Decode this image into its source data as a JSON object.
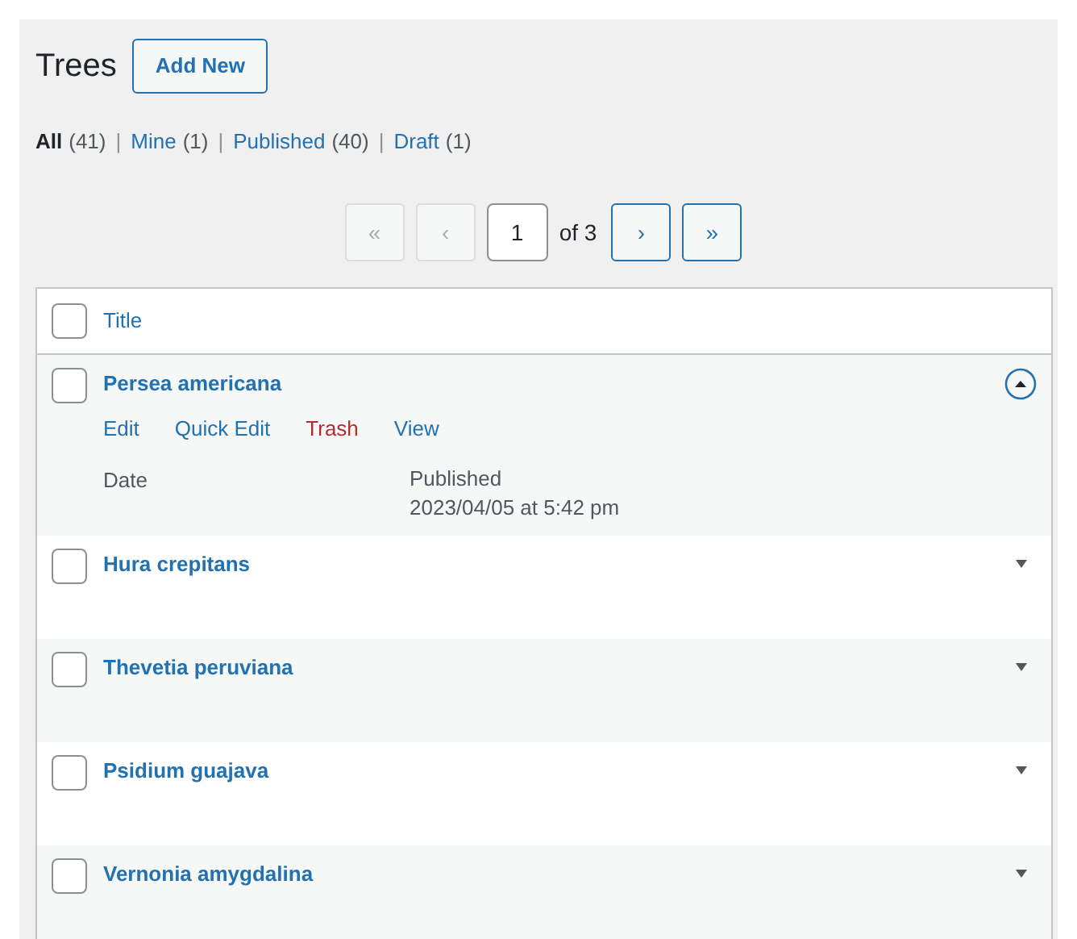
{
  "heading": {
    "title": "Trees",
    "add_button": "Add New"
  },
  "filters": [
    {
      "label": "All",
      "count": "(41)",
      "selected": true
    },
    {
      "separator": "|",
      "label": "Mine",
      "count": "(1)",
      "selected": false
    },
    {
      "separator": "|",
      "label": "Published",
      "count": "(40)",
      "selected": false
    },
    {
      "separator": "|",
      "label": "Draft",
      "count": "(1)",
      "selected": false
    }
  ],
  "pagination": {
    "first": "«",
    "prev": "‹",
    "page": "1",
    "of": "of 3",
    "next": "›",
    "last": "»",
    "first_disabled": true,
    "prev_disabled": true,
    "next_disabled": false,
    "last_disabled": false
  },
  "table": {
    "header": {
      "checked": false,
      "title": "Title"
    },
    "rows": [
      {
        "title": "Persea americana",
        "checked": false,
        "expanded": true,
        "actions": [
          {
            "kind": "normal",
            "label": "Edit"
          },
          {
            "kind": "normal",
            "label": "Quick Edit"
          },
          {
            "kind": "danger",
            "label": "Trash"
          },
          {
            "kind": "normal",
            "label": "View"
          }
        ],
        "date_label": "Date",
        "status": "Published",
        "date": "2023/04/05 at 5:42 pm"
      },
      {
        "title": "Hura crepitans",
        "checked": false,
        "expanded": false
      },
      {
        "title": "Thevetia peruviana",
        "checked": false,
        "expanded": false
      },
      {
        "title": "Psidium guajava",
        "checked": false,
        "expanded": false
      },
      {
        "title": "Vernonia amygdalina",
        "checked": false,
        "expanded": false
      }
    ]
  }
}
